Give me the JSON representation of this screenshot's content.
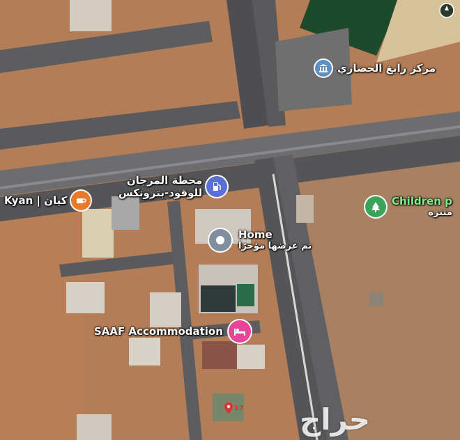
{
  "map": {
    "pois": [
      {
        "name": "مركز رابغ الحضاري",
        "sub": "",
        "icon": "museum-icon",
        "color": "#5f8fc0"
      },
      {
        "name": "محطة المرجان",
        "sub": "للوقود-بترونكس",
        "icon": "fuel-icon",
        "color": "#5b6fd6"
      },
      {
        "name": "Kyan | كيان",
        "sub": "",
        "icon": "cafe-icon",
        "color": "#e97a2a"
      },
      {
        "name": "Home",
        "sub": "تم عرضها مؤخرًا",
        "icon": "recent-place-icon",
        "color": "#7f8fa0"
      },
      {
        "name": "Children p",
        "sub": "متنزه",
        "icon": "park-icon",
        "color": "#3aa55a"
      },
      {
        "name": "SAAF Accommodation",
        "sub": "",
        "icon": "hotel-icon",
        "color": "#e8459a"
      }
    ],
    "marker": {
      "number": "17",
      "icon": "red-location-pin-icon"
    },
    "watermark": "حراج"
  }
}
